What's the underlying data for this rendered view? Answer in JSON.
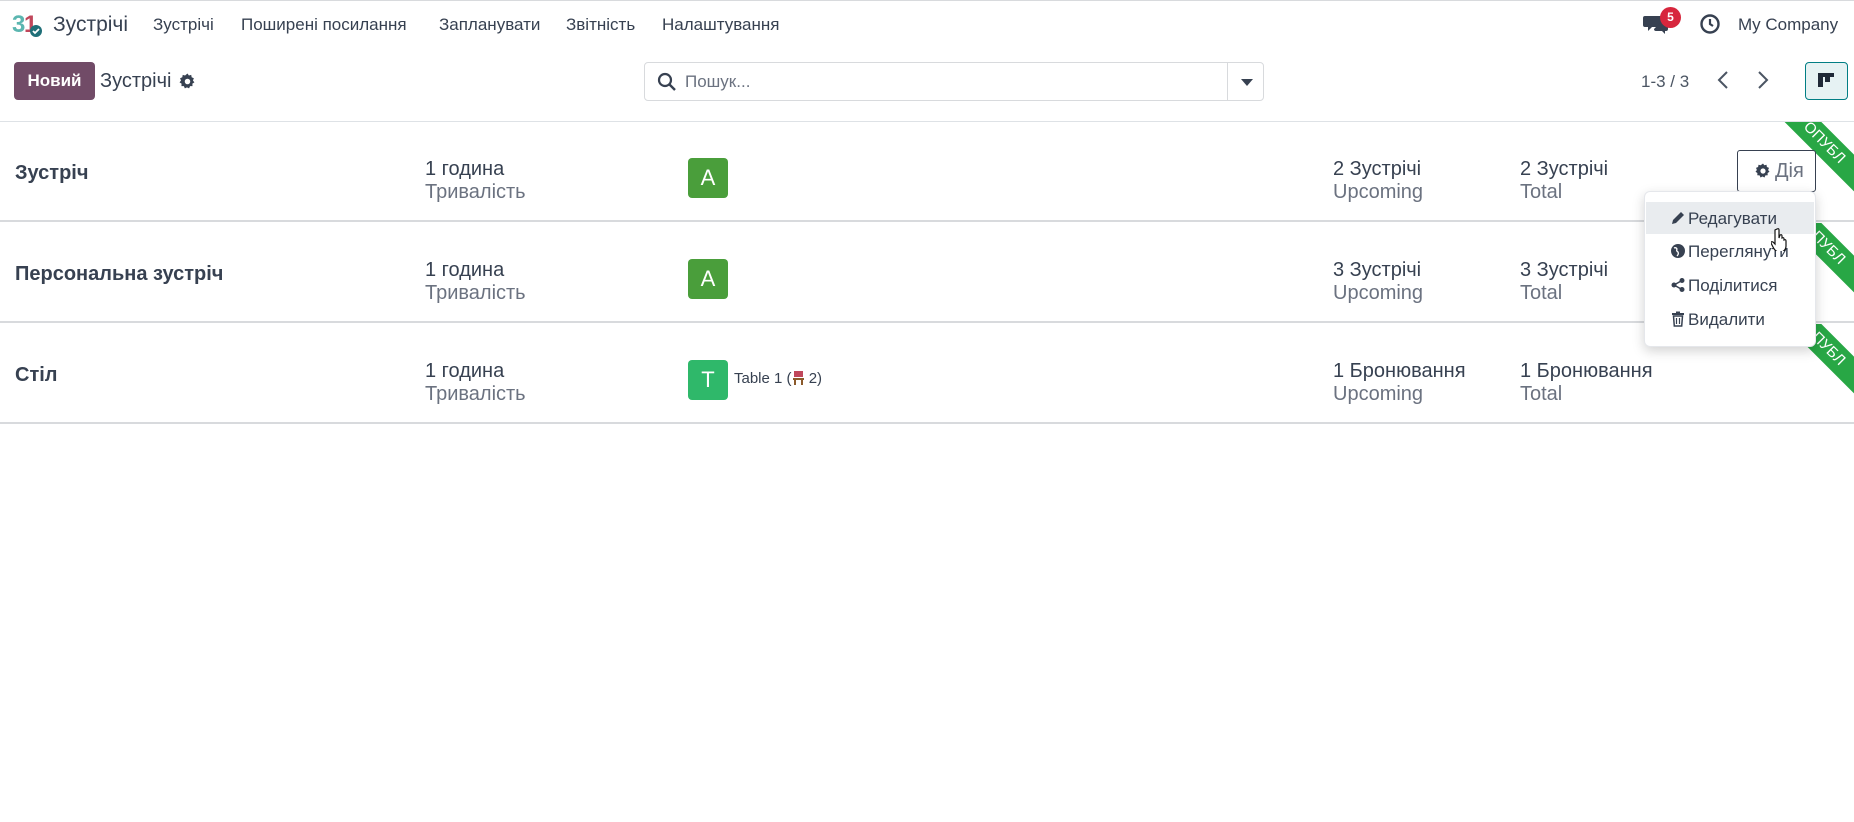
{
  "navbar": {
    "app_name": "Зустрічі",
    "menu": [
      "Зустрічі",
      "Поширені посилання",
      "Запланувати",
      "Звітність",
      "Налаштування"
    ],
    "chat_badge": "5",
    "company": "My Company"
  },
  "control_panel": {
    "new_button": "Новий",
    "breadcrumb": "Зустрічі",
    "search_placeholder": "Пошук...",
    "pager": "1-3 / 3"
  },
  "rows": [
    {
      "title": "Зустріч",
      "duration_value": "1 година",
      "duration_label": "Тривалість",
      "avatar_letter": "A",
      "avatar_color": "#4a9e3b",
      "resource_text": "",
      "resource_suffix": "",
      "upcoming_value": "2 Зустрічі",
      "upcoming_label": "Upcoming",
      "total_value": "2 Зустрічі",
      "total_label": "Total",
      "ribbon": "ОПУБЛ"
    },
    {
      "title": "Персональна зустріч",
      "duration_value": "1 година",
      "duration_label": "Тривалість",
      "avatar_letter": "A",
      "avatar_color": "#4a9e3b",
      "resource_text": "",
      "resource_suffix": "",
      "upcoming_value": "3 Зустрічі",
      "upcoming_label": "Upcoming",
      "total_value": "3 Зустрічі",
      "total_label": "Total",
      "ribbon": "ОПУБЛ"
    },
    {
      "title": "Стіл",
      "duration_value": "1 година",
      "duration_label": "Тривалість",
      "avatar_letter": "T",
      "avatar_color": "#2fb86a",
      "resource_text": "Table 1 (",
      "resource_suffix": " 2)",
      "upcoming_value": "1 Бронювання",
      "upcoming_label": "Upcoming",
      "total_value": "1 Бронювання",
      "total_label": "Total",
      "ribbon": "ОПУБЛ"
    }
  ],
  "action_button": "Дія",
  "action_menu": [
    {
      "label": "Редагувати",
      "icon": "pencil-icon"
    },
    {
      "label": "Переглянути",
      "icon": "globe-icon"
    },
    {
      "label": "Поділитися",
      "icon": "share-icon"
    },
    {
      "label": "Видалити",
      "icon": "trash-icon"
    }
  ],
  "colors": {
    "brand": "#714b67",
    "ribbon": "#28a745",
    "badge": "#d7263d",
    "kanban_active": "#017e84"
  }
}
